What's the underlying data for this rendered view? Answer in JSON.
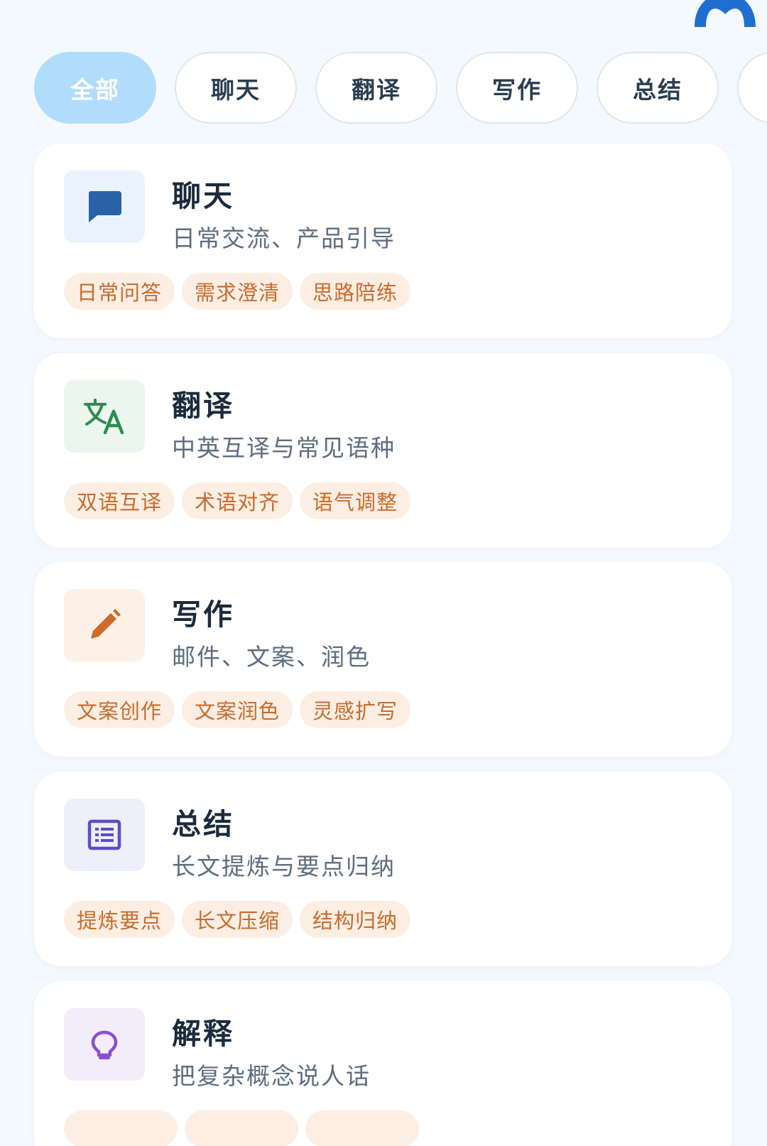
{
  "filters": [
    {
      "label": "全部",
      "active": true
    },
    {
      "label": "聊天",
      "active": false
    },
    {
      "label": "翻译",
      "active": false
    },
    {
      "label": "写作",
      "active": false
    },
    {
      "label": "总结",
      "active": false
    },
    {
      "label": "",
      "active": false
    }
  ],
  "cards": [
    {
      "title": "聊天",
      "desc": "日常交流、产品引导",
      "icon": "chat-bubble-icon",
      "icon_bg": "#eaf3fd",
      "icon_color": "#2a62a8",
      "tags": [
        "日常问答",
        "需求澄清",
        "思路陪练"
      ]
    },
    {
      "title": "翻译",
      "desc": "中英互译与常见语种",
      "icon": "translate-icon",
      "icon_bg": "#eaf6ee",
      "icon_color": "#2e8b4f",
      "tags": [
        "双语互译",
        "术语对齐",
        "语气调整"
      ]
    },
    {
      "title": "写作",
      "desc": "邮件、文案、润色",
      "icon": "pencil-icon",
      "icon_bg": "#fdf1e7",
      "icon_color": "#cf6a28",
      "tags": [
        "文案创作",
        "文案润色",
        "灵感扩写"
      ]
    },
    {
      "title": "总结",
      "desc": "长文提炼与要点归纳",
      "icon": "list-document-icon",
      "icon_bg": "#efeefb",
      "icon_color": "#5a4fc4",
      "tags": [
        "提炼要点",
        "长文压缩",
        "结构归纳"
      ]
    },
    {
      "title": "解释",
      "desc": "把复杂概念说人话",
      "icon": "lightbulb-icon",
      "icon_bg": "#f3ecfb",
      "icon_color": "#8a4fd0",
      "tags": []
    }
  ],
  "colors": {
    "page_bg": "#f4f9fe",
    "active_filter": "#b2dcfb",
    "tag_bg": "#fdeee3",
    "tag_text": "#c76c2c",
    "avatar": "#1e6fd0"
  }
}
